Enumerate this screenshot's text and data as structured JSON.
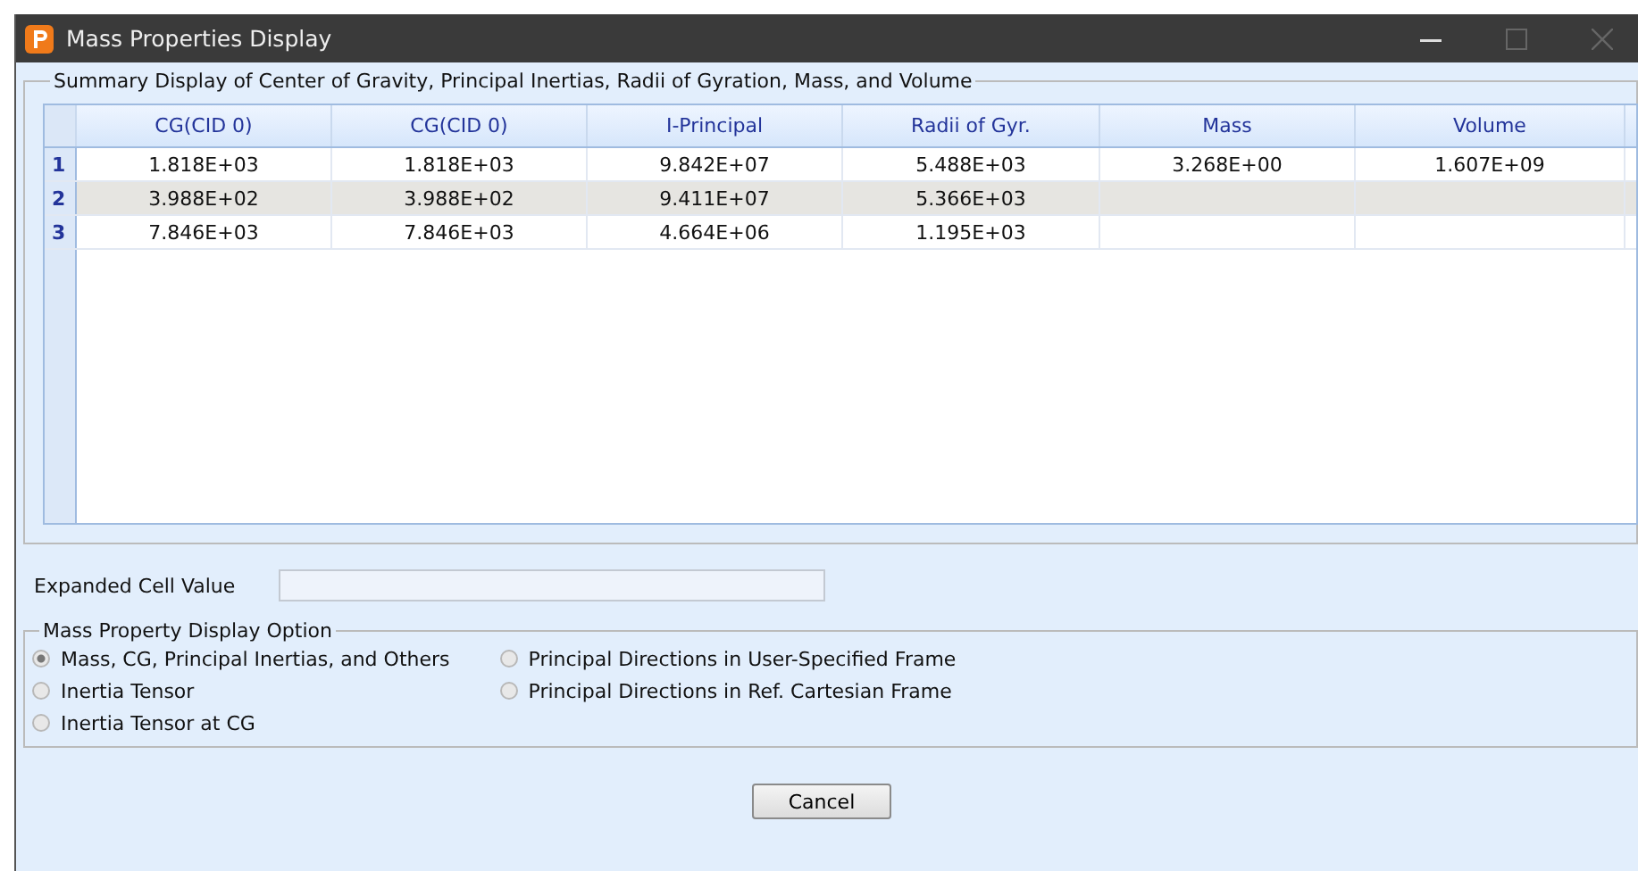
{
  "window": {
    "title": "Mass Properties Display"
  },
  "summary": {
    "title": "Summary Display of Center of Gravity, Principal Inertias, Radii of Gyration, Mass, and Volume",
    "columns": [
      "CG(CID 0)",
      "CG(CID 0)",
      "I-Principal",
      "Radii of Gyr.",
      "Mass",
      "Volume"
    ],
    "rows": [
      {
        "number": "1",
        "selected": false,
        "cells": [
          "1.818E+03",
          "1.818E+03",
          "9.842E+07",
          "5.488E+03",
          "3.268E+00",
          "1.607E+09"
        ]
      },
      {
        "number": "2",
        "selected": true,
        "cells": [
          "3.988E+02",
          "3.988E+02",
          "9.411E+07",
          "5.366E+03"
        ]
      },
      {
        "number": "3",
        "selected": false,
        "cells": [
          "7.846E+03",
          "7.846E+03",
          "4.664E+06",
          "1.195E+03"
        ]
      }
    ]
  },
  "expanded_cell": {
    "label": "Expanded Cell Value"
  },
  "display_option": {
    "title": "Mass Property Display Option",
    "options": [
      {
        "label": "Mass, CG, Principal Inertias, and Others",
        "selected": true
      },
      {
        "label": "Inertia Tensor",
        "selected": false
      },
      {
        "label": "Inertia Tensor at CG",
        "selected": false
      },
      {
        "label": "Principal Directions in User-Specified Frame",
        "selected": false
      },
      {
        "label": "Principal Directions in Ref. Cartesian Frame",
        "selected": false
      }
    ]
  },
  "buttons": [
    "Cancel"
  ]
}
